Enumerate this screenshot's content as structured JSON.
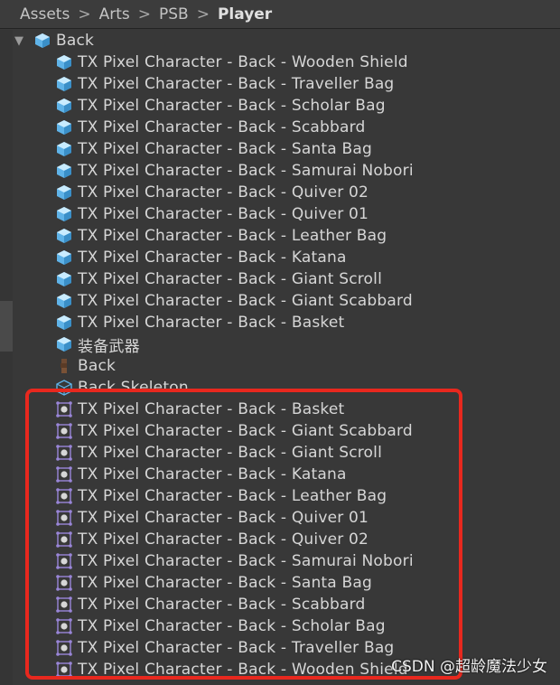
{
  "breadcrumb": {
    "items": [
      "Assets",
      "Arts",
      "PSB"
    ],
    "current": "Player",
    "separator": ">"
  },
  "tree": {
    "root_label": "Back",
    "prefab_items": [
      "TX Pixel Character - Back - Wooden Shield",
      "TX Pixel Character - Back - Traveller Bag",
      "TX Pixel Character - Back - Scholar Bag",
      "TX Pixel Character - Back - Scabbard",
      "TX Pixel Character - Back - Santa Bag",
      "TX Pixel Character - Back - Samurai Nobori",
      "TX Pixel Character - Back - Quiver 02",
      "TX Pixel Character - Back - Quiver 01",
      "TX Pixel Character - Back - Leather Bag",
      "TX Pixel Character - Back - Katana",
      "TX Pixel Character - Back - Giant Scroll",
      "TX Pixel Character - Back - Giant Scabbard",
      "TX Pixel Character - Back - Basket",
      "装备武器"
    ],
    "texture_item": "Back",
    "skeleton_item": "Back Skeleton",
    "sprite_items": [
      "TX Pixel Character - Back - Basket",
      "TX Pixel Character - Back - Giant Scabbard",
      "TX Pixel Character - Back - Giant Scroll",
      "TX Pixel Character - Back - Katana",
      "TX Pixel Character - Back - Leather Bag",
      "TX Pixel Character - Back - Quiver 01",
      "TX Pixel Character - Back - Quiver 02",
      "TX Pixel Character - Back - Samurai Nobori",
      "TX Pixel Character - Back - Santa Bag",
      "TX Pixel Character - Back - Scabbard",
      "TX Pixel Character - Back - Scholar Bag",
      "TX Pixel Character - Back - Traveller Bag",
      "TX Pixel Character - Back - Wooden Shield"
    ]
  },
  "watermark": "CSDN @超龄魔法少女",
  "colors": {
    "background": "#383838",
    "highlight_border": "#e8281e",
    "prefab_icon": "#5fb3e8",
    "sprite_icon": "#9a86d9"
  }
}
